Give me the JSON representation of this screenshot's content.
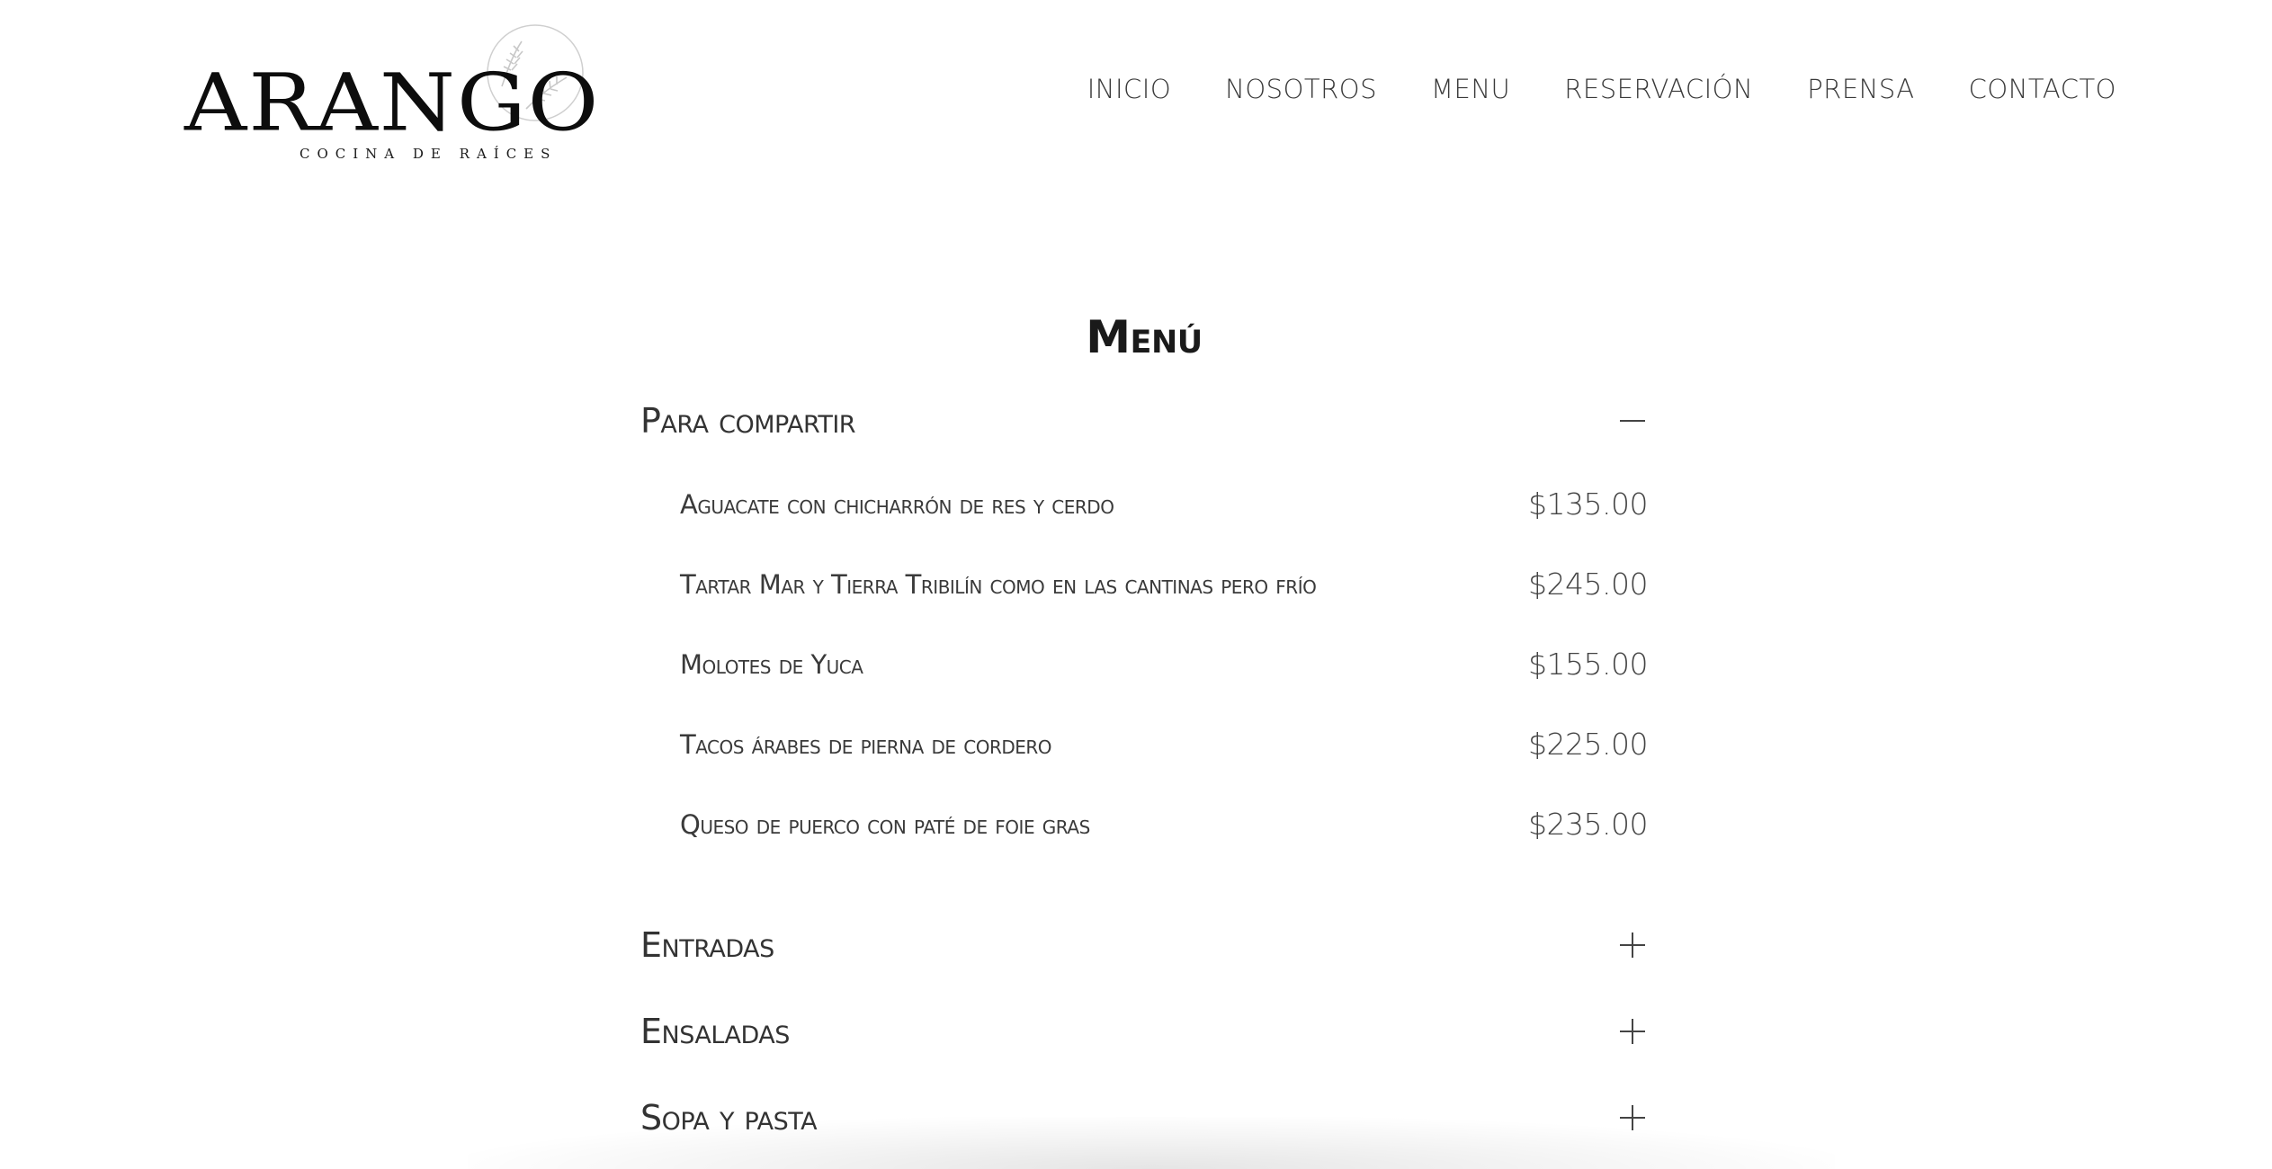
{
  "brand": {
    "name": "ARANGO",
    "tagline": "COCINA DE RAÍCES",
    "emblem_icon": "olive-branch-icon",
    "color": "#0d0d0d"
  },
  "nav": {
    "items": [
      {
        "label": "INICIO"
      },
      {
        "label": "NOSOTROS"
      },
      {
        "label": "MENU"
      },
      {
        "label": "RESERVACIÓN"
      },
      {
        "label": "PRENSA"
      },
      {
        "label": "CONTACTO"
      }
    ]
  },
  "menu": {
    "title": "Menú",
    "categories": [
      {
        "label": "Para compartir",
        "expanded": true,
        "toggle_icon": "minus-icon",
        "items": [
          {
            "name": "Aguacate con chicharrón de res y cerdo",
            "price": "$135.00"
          },
          {
            "name": "Tartar Mar y Tierra Tribilín como en las cantinas pero frío",
            "price": "$245.00"
          },
          {
            "name": "Molotes de Yuca",
            "price": "$155.00"
          },
          {
            "name": "Tacos árabes de pierna de cordero",
            "price": "$225.00"
          },
          {
            "name": "Queso de puerco con paté de foie gras",
            "price": "$235.00"
          }
        ]
      },
      {
        "label": "Entradas",
        "expanded": false,
        "toggle_icon": "plus-icon"
      },
      {
        "label": "Ensaladas",
        "expanded": false,
        "toggle_icon": "plus-icon"
      },
      {
        "label": "Sopa y pasta",
        "expanded": false,
        "toggle_icon": "plus-icon"
      }
    ]
  },
  "colors": {
    "background": "#ffffff",
    "text": "#333333",
    "icon_stroke": "#444444"
  }
}
